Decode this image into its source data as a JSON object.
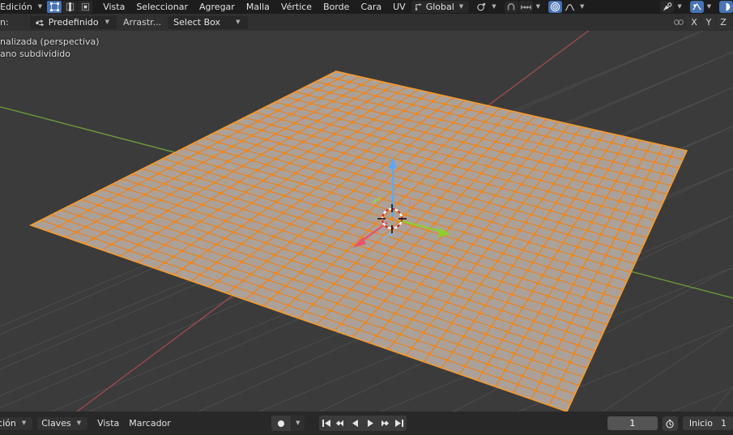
{
  "header": {
    "mode_label": "Edición",
    "mode_dropdown_icon": "chevron-down-icon",
    "select_modes": [
      {
        "name": "vertex-select-mode",
        "icon": "vertex-icon",
        "active": true
      },
      {
        "name": "edge-select-mode",
        "icon": "edge-icon",
        "active": false
      },
      {
        "name": "face-select-mode",
        "icon": "face-icon",
        "active": false
      }
    ],
    "menus": [
      "Vista",
      "Seleccionar",
      "Agregar",
      "Malla",
      "Vértice",
      "Borde",
      "Cara",
      "UV"
    ],
    "transform_orientation": "Global",
    "pivot_icon": "pivot-point-icon",
    "snap_magnet_icon": "magnet-icon",
    "snap_to_icon": "snap-increment-icon",
    "proportional_edit_icon": "proportional-editing-icon",
    "proportional_falloff_icon": "falloff-curve-icon",
    "viewport_gizmo_icon": "show-gizmo-icon",
    "viewport_overlays_icon": "overlays-icon",
    "xray_icon": "toggle-xray-icon",
    "shading_icon": "viewport-shading-icon"
  },
  "axis_lock": {
    "proportional_icon": "proportional-edit-connected-icon",
    "buttons": [
      "X",
      "Y",
      "Z"
    ]
  },
  "tool_settings": {
    "prefix_label": "n:",
    "tweak_icon": "tweak-tool-icon",
    "keymap": "Predefinido",
    "drag_label": "Arrastr...",
    "drag_mode": "Select Box"
  },
  "viewport": {
    "view_info_line1": "nalizada (perspectiva)",
    "view_info_line2": "ano subdividido",
    "background_color": "#3b3b3b",
    "grid_color": "#4f4f4f",
    "axis_x_color": "#9c4a4a",
    "axis_y_color": "#6a9c3a",
    "mesh_face_color": "#b2a59c",
    "mesh_edge_color": "#e8811f",
    "mesh_vertex_color": "#f8860d",
    "gizmo": {
      "name": "move-gizmo",
      "x_color": "#e8536a",
      "y_color": "#8ece2c",
      "z_color": "#5ea8f0",
      "cursor_icon": "3d-cursor-icon"
    }
  },
  "timeline": {
    "editor_menu": "cción",
    "keys_menu": "Claves",
    "view_menu": "Vista",
    "marker_menu": "Marcador",
    "record_icon": "record-keyframes-icon",
    "playback_buttons": [
      {
        "name": "jump-to-start-button",
        "icon": "skip-start-icon"
      },
      {
        "name": "prev-keyframe-button",
        "icon": "prev-keyframe-icon"
      },
      {
        "name": "play-reverse-button",
        "icon": "play-reverse-icon"
      },
      {
        "name": "play-button",
        "icon": "play-icon"
      },
      {
        "name": "next-keyframe-button",
        "icon": "next-keyframe-icon"
      },
      {
        "name": "jump-to-end-button",
        "icon": "skip-end-icon"
      }
    ],
    "current_frame": "1",
    "timer_icon": "auto-key-timer-icon",
    "start_label": "Inicio",
    "start_value": "1"
  }
}
